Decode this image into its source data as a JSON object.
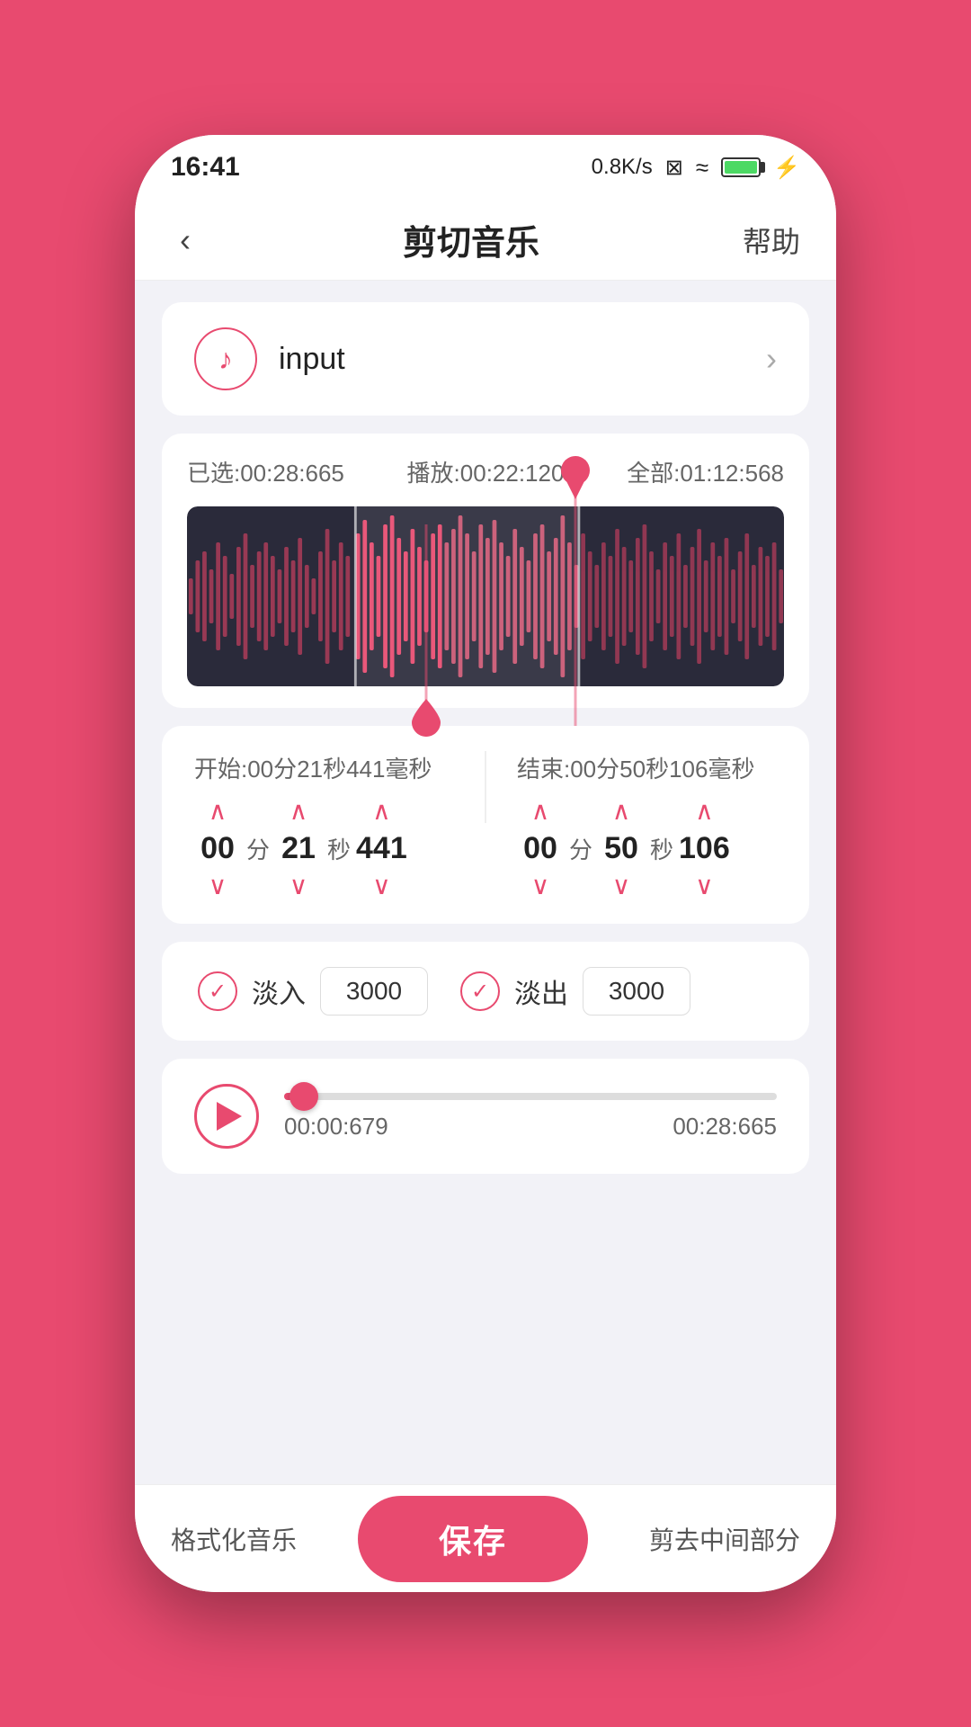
{
  "statusBar": {
    "time": "16:41",
    "network": "0.8K/s",
    "battery": "100"
  },
  "header": {
    "back": "‹",
    "title": "剪切音乐",
    "help": "帮助"
  },
  "inputSelector": {
    "iconLabel": "♪",
    "filename": "input",
    "chevron": "›"
  },
  "waveform": {
    "selected": "已选:00:28:665",
    "playback": "播放:00:22:120",
    "total": "全部:01:12:568"
  },
  "timeAdjust": {
    "startLabel": "开始:00分21秒441毫秒",
    "endLabel": "结束:00分50秒106毫秒",
    "start": {
      "min": "00",
      "sec": "21",
      "ms": "441"
    },
    "end": {
      "min": "00",
      "sec": "50",
      "ms": "106"
    },
    "unitMin": "分",
    "unitSec": "秒"
  },
  "fade": {
    "fadeInLabel": "淡入",
    "fadeInValue": "3000",
    "fadeOutLabel": "淡出",
    "fadeOutValue": "3000"
  },
  "player": {
    "currentTime": "00:00:679",
    "totalTime": "00:28:665",
    "progressPercent": 4
  },
  "bottomBar": {
    "formatMusic": "格式化音乐",
    "save": "保存",
    "trimMiddle": "剪去中间部分"
  }
}
